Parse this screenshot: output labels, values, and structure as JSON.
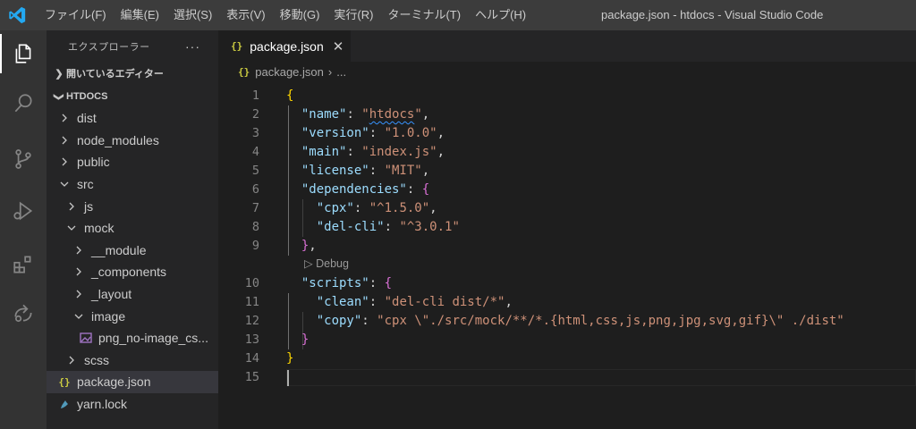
{
  "window": {
    "title": "package.json - htdocs - Visual Studio Code",
    "brand_color": "#23a9f2"
  },
  "menu": [
    "ファイル(F)",
    "編集(E)",
    "選択(S)",
    "表示(V)",
    "移動(G)",
    "実行(R)",
    "ターミナル(T)",
    "ヘルプ(H)"
  ],
  "activity_bar": [
    "explorer-icon",
    "search-icon",
    "source-control-icon",
    "run-debug-icon",
    "extensions-icon",
    "remote-icon"
  ],
  "sidebar": {
    "title": "エクスプローラー",
    "more": "···",
    "open_editors": "開いているエディター",
    "project": "HTDOCS",
    "tree": [
      {
        "label": "dist",
        "chevron": "right"
      },
      {
        "label": "node_modules",
        "chevron": "right"
      },
      {
        "label": "public",
        "chevron": "right"
      },
      {
        "label": "src",
        "chevron": "down"
      },
      {
        "label": "js",
        "chevron": "right"
      },
      {
        "label": "mock",
        "chevron": "down"
      },
      {
        "label": "__module",
        "chevron": "right"
      },
      {
        "label": "_components",
        "chevron": "right"
      },
      {
        "label": "_layout",
        "chevron": "right"
      },
      {
        "label": "image",
        "chevron": "down"
      },
      {
        "label": "png_no-image_cs...",
        "icon": "image-file-icon"
      },
      {
        "label": "scss",
        "chevron": "right"
      },
      {
        "label": "package.json",
        "icon": "json-file-icon",
        "selected": true
      },
      {
        "label": "yarn.lock",
        "icon": "yarn-file-icon"
      }
    ]
  },
  "editor": {
    "tab": {
      "label": "package.json",
      "icon_text": "{}",
      "close": "✕"
    },
    "breadcrumb": {
      "file": "package.json",
      "rest": "..."
    },
    "codelens": "Debug",
    "line_numbers": [
      "1",
      "2",
      "3",
      "4",
      "5",
      "6",
      "7",
      "8",
      "9",
      "10",
      "11",
      "12",
      "13",
      "14",
      "15"
    ],
    "code": {
      "l1": "{",
      "name_key": "\"name\"",
      "name_val": "htdocs",
      "version_key": "\"version\"",
      "version_val": "\"1.0.0\"",
      "main_key": "\"main\"",
      "main_val": "\"index.js\"",
      "license_key": "\"license\"",
      "license_val": "\"MIT\"",
      "deps_key": "\"dependencies\"",
      "cpx_key": "\"cpx\"",
      "cpx_val": "\"^1.5.0\"",
      "delcli_key": "\"del-cli\"",
      "delcli_val": "\"^3.0.1\"",
      "scripts_key": "\"scripts\"",
      "clean_key": "\"clean\"",
      "clean_val": "\"del-cli dist/*\"",
      "copy_key": "\"copy\"",
      "copy_val": "\"cpx \\\"./src/mock/**/*.{html,css,js,png,jpg,svg,gif}\\\" ./dist\"",
      "close_brace": "}"
    }
  }
}
